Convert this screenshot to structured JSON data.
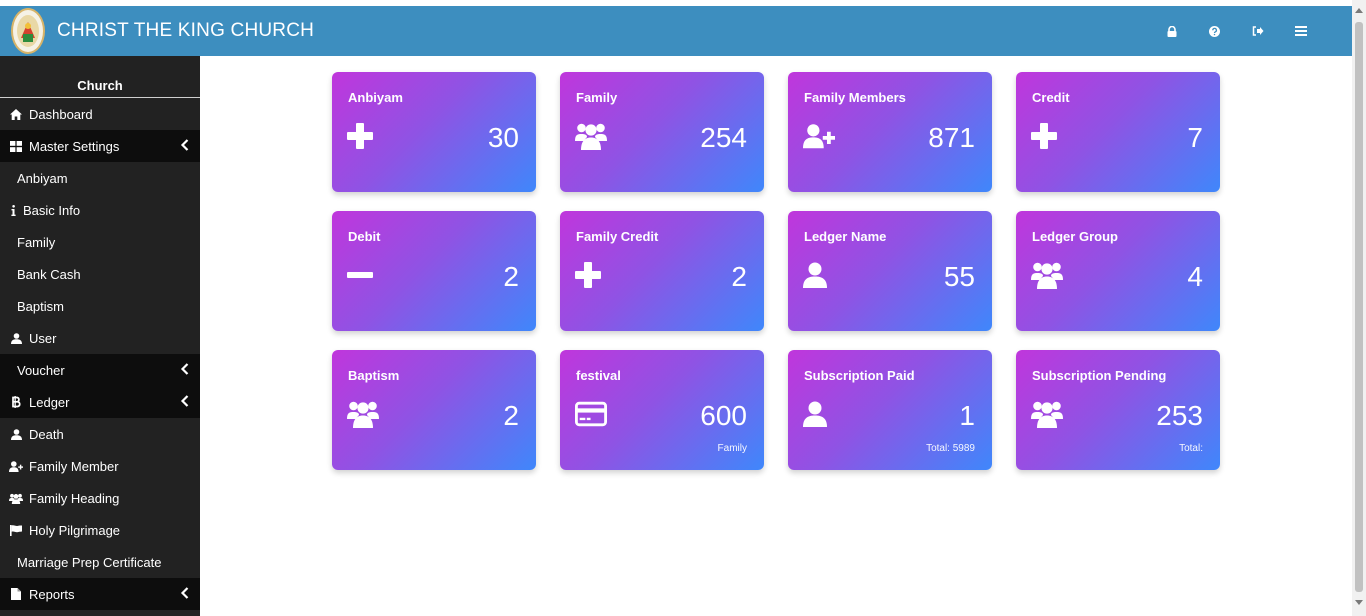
{
  "header": {
    "title": "CHRIST THE KING CHURCH"
  },
  "colors": {
    "header": "#3d8ebf",
    "sidebar": "#222222",
    "card_start": "#c036dc",
    "card_end": "#3f87fb"
  },
  "header_icons": [
    "lock-icon",
    "question-circle-icon",
    "sign-out-icon",
    "menu-icon"
  ],
  "sidebar": {
    "title": "Church",
    "items": [
      {
        "label": "Dashboard",
        "icon": "home-icon"
      },
      {
        "label": "Master Settings",
        "icon": "th-large-icon"
      },
      {
        "label": "Anbiyam"
      },
      {
        "label": "Basic Info",
        "icon": "info-icon"
      },
      {
        "label": "Family"
      },
      {
        "label": "Bank Cash"
      },
      {
        "label": "Baptism"
      },
      {
        "label": "User",
        "icon": "user-icon"
      },
      {
        "label": "Voucher"
      },
      {
        "label": "Ledger",
        "icon": "bitcoin-icon"
      },
      {
        "label": "Death",
        "icon": "user-icon"
      },
      {
        "label": "Family Member",
        "icon": "user-plus-icon"
      },
      {
        "label": "Family Heading",
        "icon": "users-icon"
      },
      {
        "label": "Holy Pilgrimage",
        "icon": "flag-icon"
      },
      {
        "label": "Marriage Prep Certificate"
      },
      {
        "label": "Reports",
        "icon": "file-icon"
      }
    ]
  },
  "cards": [
    {
      "label": "Anbiyam",
      "value": "30",
      "icon": "plus-icon"
    },
    {
      "label": "Family",
      "value": "254",
      "icon": "users-icon"
    },
    {
      "label": "Family Members",
      "value": "871",
      "icon": "user-plus-icon"
    },
    {
      "label": "Credit",
      "value": "7",
      "icon": "plus-icon"
    },
    {
      "label": "Debit",
      "value": "2",
      "icon": "minus-icon"
    },
    {
      "label": "Family Credit",
      "value": "2",
      "icon": "plus-icon"
    },
    {
      "label": "Ledger Name",
      "value": "55",
      "icon": "user-icon"
    },
    {
      "label": "Ledger Group",
      "value": "4",
      "icon": "users-icon"
    },
    {
      "label": "Baptism",
      "value": "2",
      "icon": "users-icon"
    },
    {
      "label": "festival",
      "value": "600",
      "sub": "Family",
      "icon": "credit-card-icon"
    },
    {
      "label": "Subscription Paid",
      "value": "1",
      "sub": "Total: 5989",
      "icon": "user-icon"
    },
    {
      "label": "Subscription Pending",
      "value": "253",
      "sub": "Total:",
      "icon": "users-icon"
    }
  ]
}
